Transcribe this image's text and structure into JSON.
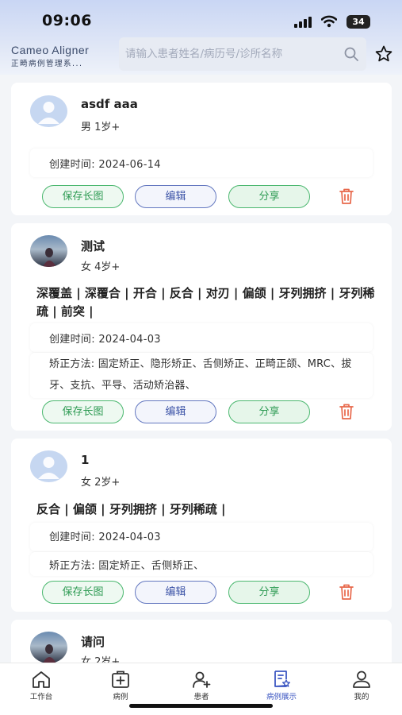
{
  "status": {
    "time": "09:06",
    "battery": "34"
  },
  "brand": {
    "name": "Cameo Aligner",
    "subtitle": "正畸病例管理系..."
  },
  "search": {
    "placeholder": "请输入患者姓名/病历号/诊所名称"
  },
  "cards": [
    {
      "name": "asdf aaa",
      "meta": "男 1岁+",
      "tags": "",
      "created_label": "创建时间: ",
      "created": "2024-06-14",
      "method": ""
    },
    {
      "name": "测试",
      "meta": "女 4岁+",
      "tags": "深覆盖 | 深覆合 | 开合 | 反合 | 对刃 | 偏颌 | 牙列拥挤 | 牙列稀疏 | 前突 |",
      "created_label": "创建时间: ",
      "created": "2024-04-03",
      "method": "矫正方法: 固定矫正、隐形矫正、舌侧矫正、正畸正颌、MRC、拔牙、支抗、平导、活动矫治器、"
    },
    {
      "name": "1",
      "meta": "女 2岁+",
      "tags": "反合 | 偏颌 | 牙列拥挤 | 牙列稀疏 |",
      "created_label": "创建时间: ",
      "created": "2024-04-03",
      "method": "矫正方法: 固定矫正、舌侧矫正、"
    },
    {
      "name": "请问",
      "meta": "女 2岁+"
    }
  ],
  "buttons": {
    "save": "保存长图",
    "edit": "编辑",
    "share": "分享"
  },
  "tabs": [
    {
      "label": "工作台",
      "icon": "home-icon"
    },
    {
      "label": "病例",
      "icon": "medical-case-icon"
    },
    {
      "label": "患者",
      "icon": "add-user-icon"
    },
    {
      "label": "病例展示",
      "icon": "case-display-icon",
      "active": true
    },
    {
      "label": "我的",
      "icon": "profile-icon"
    }
  ],
  "colors": {
    "accent": "#3d57c2",
    "green": "#2e9b54",
    "danger": "#e8674a"
  }
}
